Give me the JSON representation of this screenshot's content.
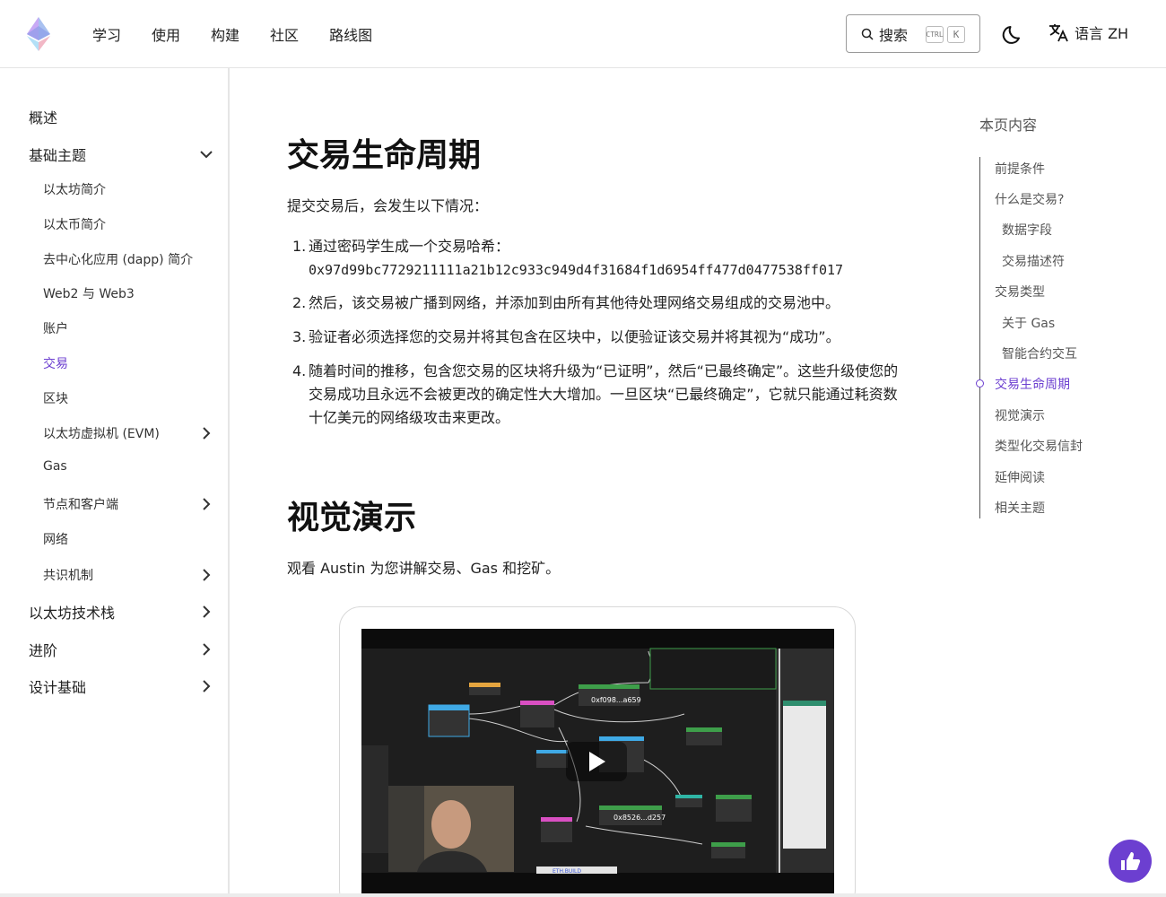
{
  "header": {
    "nav": [
      "学习",
      "使用",
      "构建",
      "社区",
      "路线图"
    ],
    "search_label": "搜索",
    "search_kbd_ctrl": "CTRL",
    "search_kbd_k": "K",
    "lang_label": "语言 ZH"
  },
  "sidebar": {
    "overview": "概述",
    "basics": "基础主题",
    "sub_items": [
      "以太坊简介",
      "以太币简介",
      "去中心化应用 (dapp) 简介",
      "Web2 与 Web3",
      "账户",
      "交易",
      "区块",
      "以太坊虚拟机 (EVM)",
      "Gas",
      "节点和客户端",
      "网络",
      "共识机制"
    ],
    "active_sub": "交易",
    "stack": "以太坊技术栈",
    "advanced": "进阶",
    "design": "设计基础"
  },
  "main": {
    "title": "交易生命周期",
    "intro": "提交交易后，会发生以下情况：",
    "steps": [
      "通过密码学生成一个交易哈希：",
      "然后，该交易被广播到网络，并添加到由所有其他待处理网络交易组成的交易池中。",
      "验证者必须选择您的交易并将其包含在区块中，以便验证该交易并将其视为“成功”。",
      "随着时间的推移，包含您交易的区块将升级为“已证明”，然后“已最终确定”。这些升级使您的交易成功且永远不会被更改的确定性大大增加。一旦区块“已最终确定”，它就只能通过耗资数十亿美元的网络级攻击来更改。"
    ],
    "hash": "0x97d99bc7729211111a21b12c933c949d4f31684f1d6954ff477d0477538ff017",
    "visual_title": "视觉演示",
    "visual_intro": "观看 Austin 为您讲解交易、Gas 和挖矿。",
    "video_labels": [
      "0xf098...a659",
      "0x8526...d257",
      "ETH.BUILD"
    ]
  },
  "toc": {
    "title": "本页内容",
    "items": [
      "前提条件",
      "什么是交易?",
      "数据字段",
      "交易描述符",
      "交易类型",
      "关于 Gas",
      "智能合约交互",
      "交易生命周期",
      "视觉演示",
      "类型化交易信封",
      "延伸阅读",
      "相关主题"
    ],
    "active": "交易生命周期"
  },
  "colors": {
    "accent": "#6c3fd0"
  }
}
